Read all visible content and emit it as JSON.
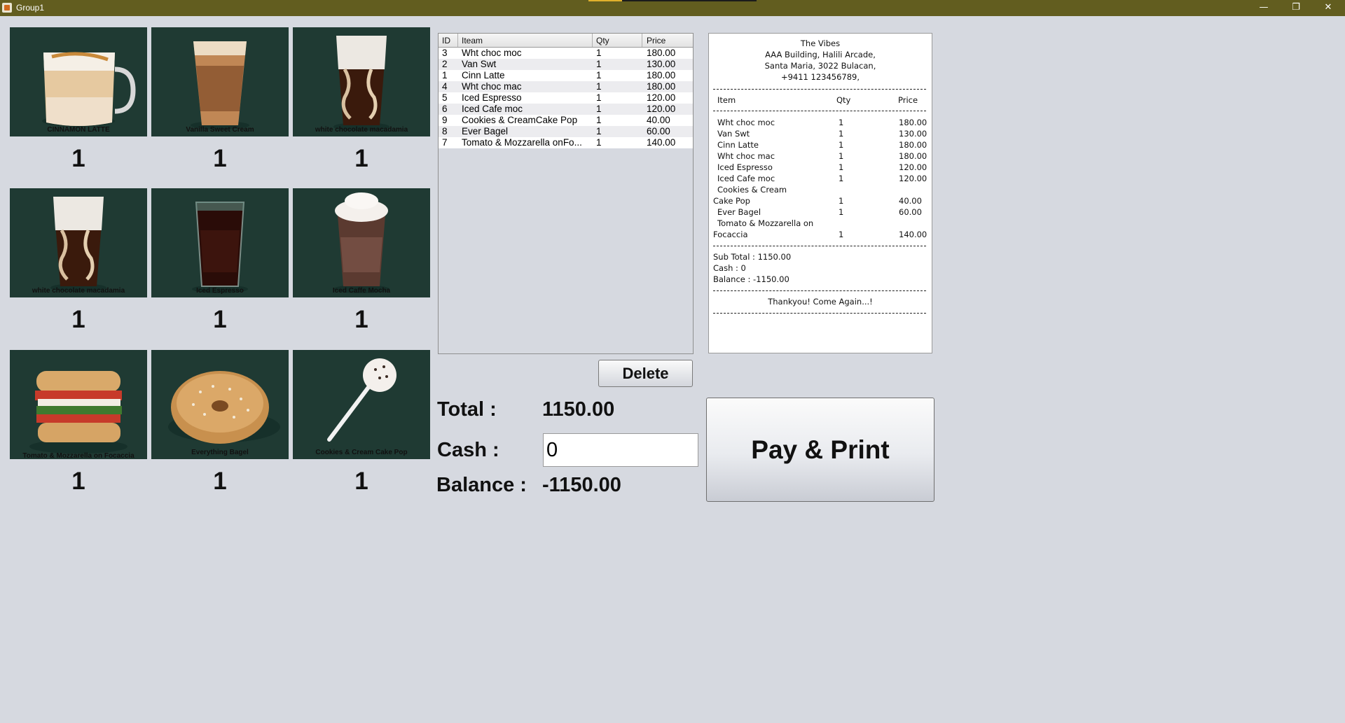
{
  "window": {
    "title": "Group1",
    "minimize": "—",
    "restore": "❐",
    "close": "✕"
  },
  "products": [
    {
      "caption": "CINNAMON LATTE",
      "count": "1",
      "kind": "latte"
    },
    {
      "caption": "Vanilla Sweet Cream",
      "count": "1",
      "kind": "coldbrew"
    },
    {
      "caption": "white chocolate macadamia",
      "count": "1",
      "kind": "swirl"
    },
    {
      "caption": "white chocolate macadamia",
      "count": "1",
      "kind": "swirl"
    },
    {
      "caption": "Iced Espresso",
      "count": "1",
      "kind": "espresso"
    },
    {
      "caption": "Iced Caffe Mocha",
      "count": "1",
      "kind": "mocha"
    },
    {
      "caption": "Tomato & Mozzarella on Focaccia",
      "count": "1",
      "kind": "sandwich"
    },
    {
      "caption": "Everything Bagel",
      "count": "1",
      "kind": "bagel"
    },
    {
      "caption": "Cookies & Cream Cake Pop",
      "count": "1",
      "kind": "cakepop"
    }
  ],
  "order_table": {
    "columns": [
      "ID",
      "Iteam",
      "Qty",
      "Price"
    ],
    "rows": [
      [
        "3",
        "Wht choc moc",
        "1",
        "180.00"
      ],
      [
        "2",
        "Van Swt",
        "1",
        "130.00"
      ],
      [
        "1",
        "Cinn Latte",
        "1",
        "180.00"
      ],
      [
        "4",
        "Wht choc mac",
        "1",
        "180.00"
      ],
      [
        "5",
        "Iced Espresso",
        "1",
        "120.00"
      ],
      [
        "6",
        "Iced Cafe moc",
        "1",
        "120.00"
      ],
      [
        "9",
        "Cookies & CreamCake Pop",
        "1",
        "40.00"
      ],
      [
        "8",
        "Ever Bagel",
        "1",
        "60.00"
      ],
      [
        "7",
        "Tomato & Mozzarella onFo...",
        "1",
        "140.00"
      ]
    ]
  },
  "receipt": {
    "header": [
      "The Vibes",
      "AAA Building, Halili Arcade,",
      "Santa Maria, 3022 Bulacan,",
      "+9411 123456789,"
    ],
    "columns": [
      "Item",
      "Qty",
      "Price"
    ],
    "lines": [
      {
        "item": "Wht choc moc",
        "qty": "1",
        "price": "180.00"
      },
      {
        "item": "Van Swt",
        "qty": "1",
        "price": "130.00"
      },
      {
        "item": "Cinn Latte",
        "qty": "1",
        "price": "180.00"
      },
      {
        "item": "Wht choc mac",
        "qty": "1",
        "price": "180.00"
      },
      {
        "item": "Iced Espresso",
        "qty": "1",
        "price": "120.00"
      },
      {
        "item": "Iced Cafe moc",
        "qty": "1",
        "price": "120.00"
      },
      {
        "item": "Cookies & Cream",
        "qty": "",
        "price": ""
      },
      {
        "item": "Cake Pop",
        "qty": "1",
        "price": "40.00",
        "wrap": true
      },
      {
        "item": "Ever Bagel",
        "qty": "1",
        "price": "60.00"
      },
      {
        "item": "Tomato & Mozzarella on",
        "qty": "",
        "price": ""
      },
      {
        "item": "Focaccia",
        "qty": "1",
        "price": "140.00",
        "wrap": true
      }
    ],
    "subtotal": "Sub Total : 1150.00",
    "cash": "Cash     : 0",
    "balance": "Balance   : -1150.00",
    "footer": "Thankyou! Come Again...!"
  },
  "actions": {
    "delete_label": "Delete",
    "pay_label": "Pay & Print"
  },
  "totals": {
    "total_label": "Total :",
    "total_value": "1150.00",
    "cash_label": "Cash :",
    "cash_value": "0",
    "balance_label": "Balance :",
    "balance_value": "-1150.00"
  },
  "colors": {
    "titlebar": "#625d1f",
    "tile_bg": "#1f3a33",
    "background": "#d6d9e0"
  }
}
